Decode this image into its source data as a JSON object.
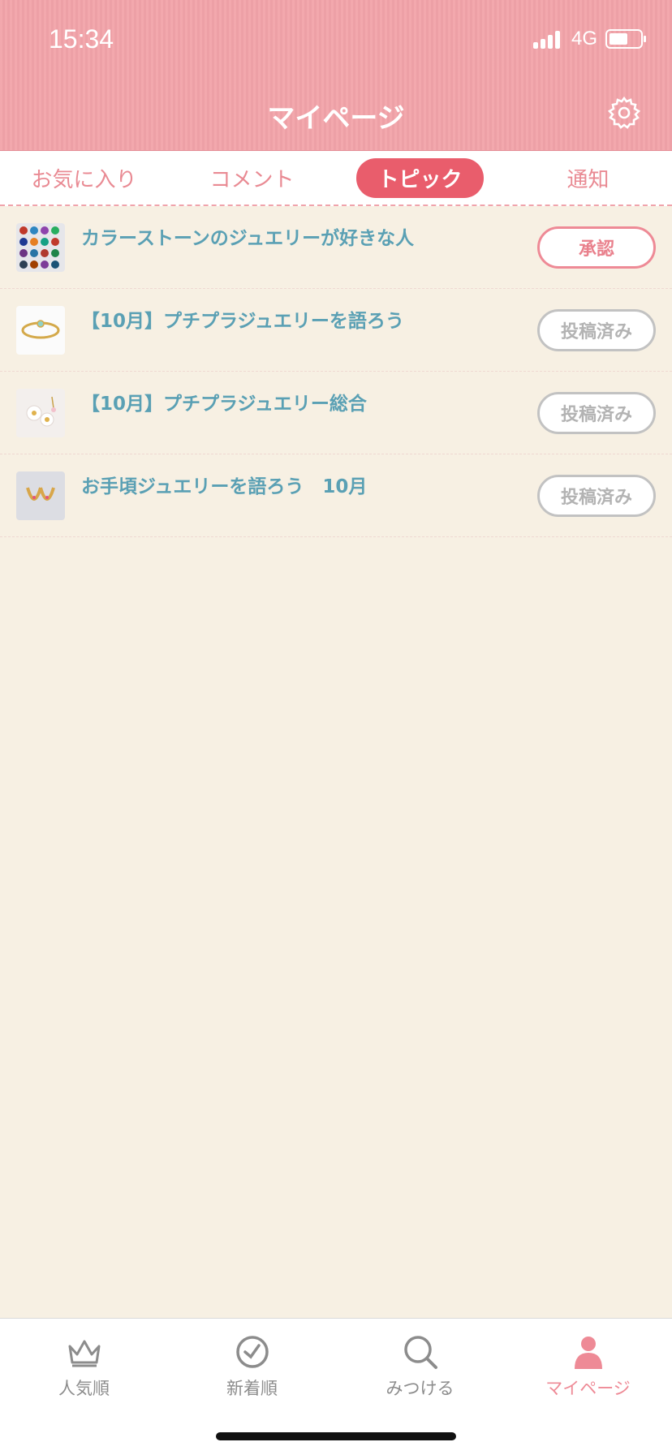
{
  "status": {
    "time": "15:34",
    "network": "4G"
  },
  "header": {
    "title": "マイページ"
  },
  "tabs": [
    {
      "label": "お気に入り",
      "active": false
    },
    {
      "label": "コメント",
      "active": false
    },
    {
      "label": "トピック",
      "active": true
    },
    {
      "label": "通知",
      "active": false
    }
  ],
  "topics": [
    {
      "title": "カラーストーンのジュエリーが好きな人",
      "status": "承認",
      "thumb_icon": "colorstone-rings-image"
    },
    {
      "title": "【10月】プチプラジュエリーを語ろう",
      "status": "投稿済み",
      "thumb_icon": "gold-ring-image"
    },
    {
      "title": "【10月】プチプラジュエリー総合",
      "status": "投稿済み",
      "thumb_icon": "flower-jewelry-image"
    },
    {
      "title": "お手頃ジュエリーを語ろう　10月",
      "status": "投稿済み",
      "thumb_icon": "gold-earrings-image"
    }
  ],
  "bottom_nav": [
    {
      "label": "人気順",
      "icon": "crown-icon"
    },
    {
      "label": "新着順",
      "icon": "clock-icon"
    },
    {
      "label": "みつける",
      "icon": "search-icon"
    },
    {
      "label": "マイページ",
      "icon": "person-icon",
      "active": true
    }
  ],
  "colors": {
    "header": "#f2a3a9",
    "accent": "#e95d6c",
    "link": "#5aa0b4",
    "background": "#f7f0e3"
  }
}
